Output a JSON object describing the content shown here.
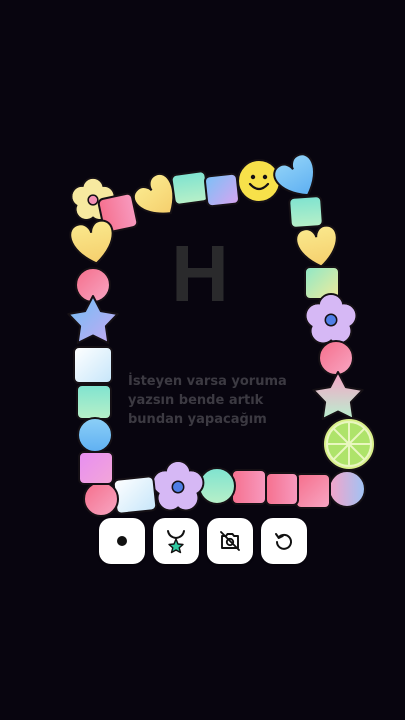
{
  "canvas": {
    "letter": "H",
    "caption_lines": [
      "İsteyen varsa yoruma",
      "yazsın bende artık",
      "bundan yapacağım"
    ]
  },
  "colors": {
    "background": "#08050f",
    "pink": "#f58ab6",
    "mint": "#8ee8c0",
    "yellow": "#f9e08a",
    "blue": "#8ab8f5",
    "lavender": "#c7a4f0",
    "white": "#ffffff"
  },
  "toolbar": {
    "buttons": [
      {
        "name": "record-button",
        "icon": "dot-icon"
      },
      {
        "name": "charm-button",
        "icon": "star-necklace-icon"
      },
      {
        "name": "camera-off-button",
        "icon": "camera-off-icon"
      },
      {
        "name": "undo-button",
        "icon": "rotate-ccw-icon"
      }
    ]
  }
}
